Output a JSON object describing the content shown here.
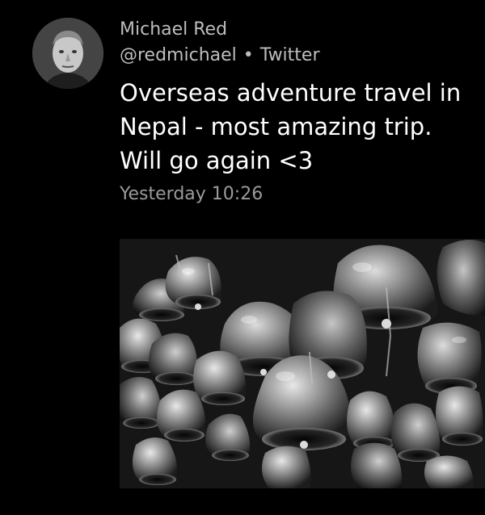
{
  "tweet": {
    "author_name": "Michael Red",
    "handle": "@redmichael",
    "separator": "•",
    "source": "Twitter",
    "text": "Overseas adventure travel in Nepal - most amazing trip. Will go again <3",
    "timestamp": "Yesterday 10:26"
  },
  "colors": {
    "background": "#000000",
    "primary_text": "#ffffff",
    "secondary_text": "#bdbdbd",
    "timestamp_text": "#9a9a9a"
  },
  "icons": {
    "avatar": "profile-photo",
    "media": "photo-bells"
  }
}
